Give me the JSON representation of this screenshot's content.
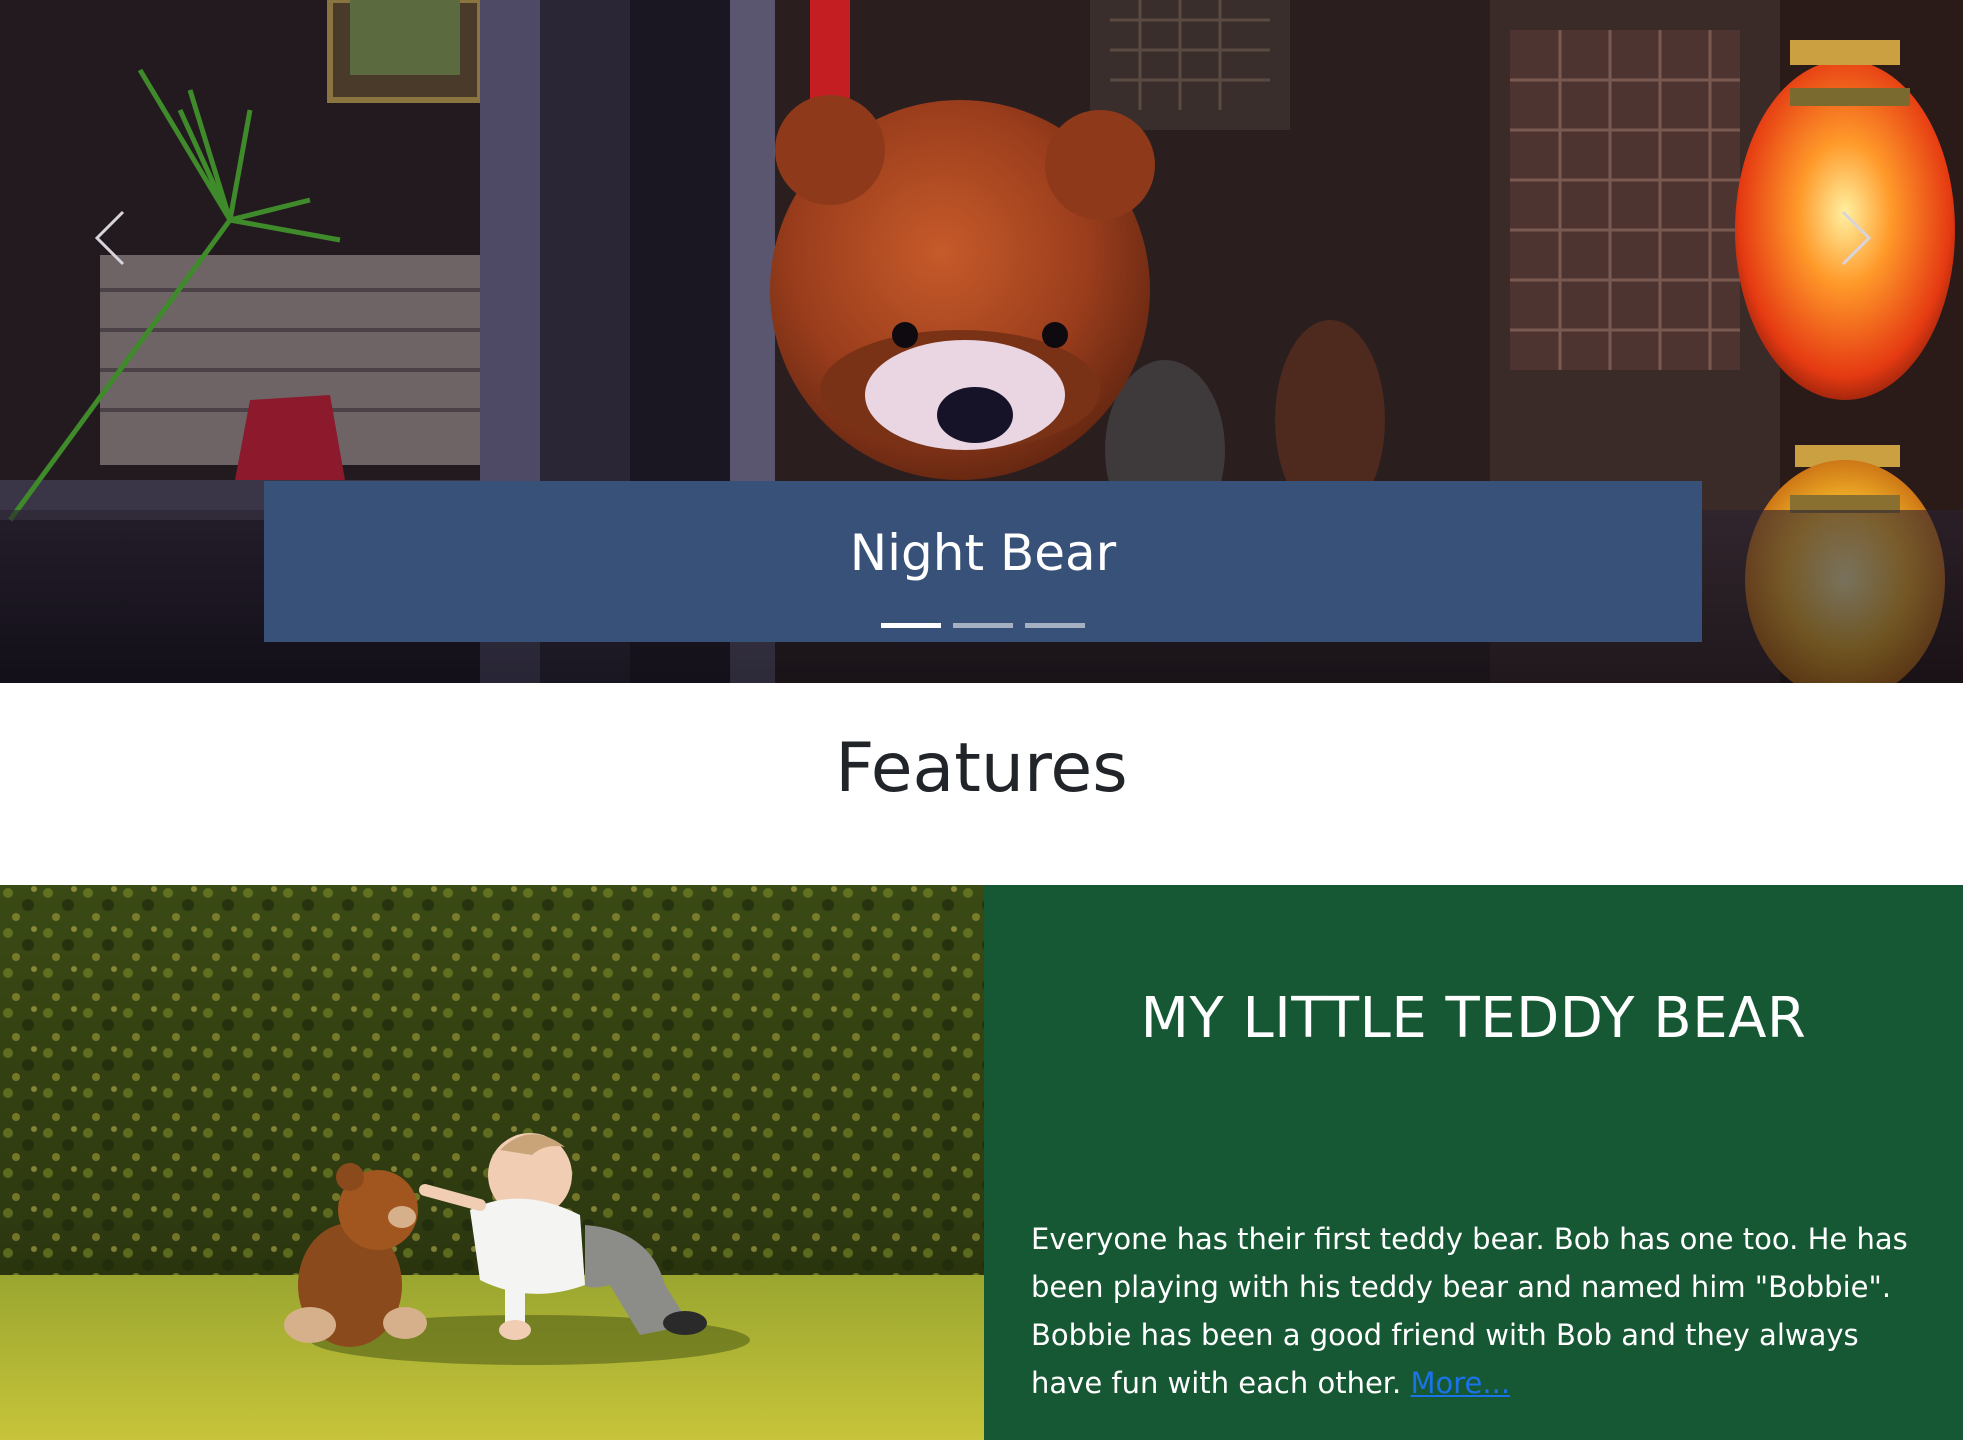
{
  "carousel": {
    "caption": "Night Bear",
    "prev_icon": "chevron-left-icon",
    "next_icon": "chevron-right-icon",
    "slide_count": 3,
    "active_slide": 1,
    "caption_bg": "#385178"
  },
  "features": {
    "heading": "Features",
    "card": {
      "title": "MY LITTLE TEDDY BEAR",
      "body": "Everyone has their first teddy bear. Bob has one too. He has been playing with his teddy bear and named him \"Bobbie\". Bobbie has been a good friend with Bob and they always have fun with each other.",
      "link_label": "More...",
      "panel_bg": "#175834",
      "link_color": "#1a73e8"
    }
  }
}
